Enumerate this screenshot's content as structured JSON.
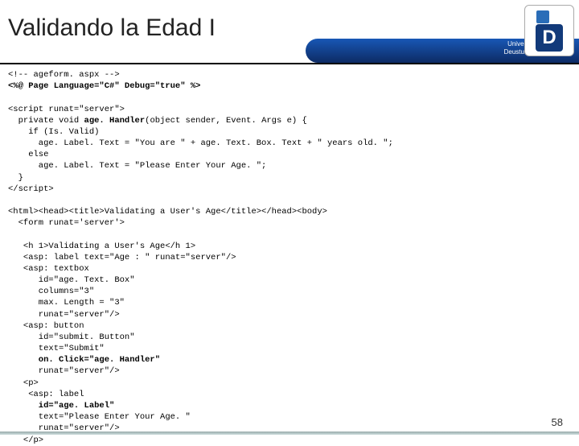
{
  "title": "Validando la Edad I",
  "logo": {
    "letter": "D",
    "uni_line1": "Universidad de Deusto",
    "uni_line2": "Deustuko Unibertsitatea"
  },
  "code": {
    "l1": "<!-- ageform. aspx -->",
    "l2": "<%@ Page Language=\"C#\" Debug=\"true\" %>",
    "l3": "",
    "l4": "<script runat=\"server\">",
    "l5a": "  private void ",
    "l5b": "age. Handler",
    "l5c": "(object sender, Event. Args e) {",
    "l6": "    if (Is. Valid)",
    "l7": "      age. Label. Text = \"You are \" + age. Text. Box. Text + \" years old. \";",
    "l8": "    else",
    "l9": "      age. Label. Text = \"Please Enter Your Age. \";",
    "l10": "  }",
    "l11": "</script>",
    "l12": "",
    "l13": "<html><head><title>Validating a User's Age</title></head><body>",
    "l14": "  <form runat='server'>",
    "l15": "",
    "l16": "   <h 1>Validating a User's Age</h 1>",
    "l17": "   <asp: label text=\"Age : \" runat=\"server\"/>",
    "l18": "   <asp: textbox",
    "l19": "      id=\"age. Text. Box\"",
    "l20": "      columns=\"3\"",
    "l21": "      max. Length = \"3\"",
    "l22": "      runat=\"server\"/>",
    "l23": "   <asp: button",
    "l24": "      id=\"submit. Button\"",
    "l25": "      text=\"Submit\"",
    "l26": "      on. Click=\"age. Handler\"",
    "l27": "      runat=\"server\"/>",
    "l28": "   <p>",
    "l29": "    <asp: label",
    "l30": "      id=\"age. Label\"",
    "l31": "      text=\"Please Enter Your Age. \"",
    "l32": "      runat=\"server\"/>",
    "l33": "   </p>"
  },
  "page_number": "58"
}
